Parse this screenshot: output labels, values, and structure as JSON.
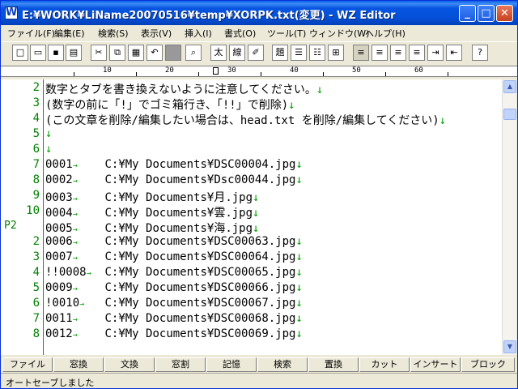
{
  "window": {
    "title": "E:¥WORK¥LiName20070516¥temp¥XORPK.txt(変更) - WZ Editor",
    "icon_glyph": "W"
  },
  "title_buttons": {
    "minimize": "_",
    "maximize": "□",
    "close": "✕"
  },
  "menu": [
    "ファイル(F)",
    "編集(E)",
    "検索(S)",
    "表示(V)",
    "挿入(I)",
    "書式(O)",
    "ツール(T)",
    "ウィンドウ(W)",
    "ヘルプ(H)"
  ],
  "toolbar": {
    "new": "□",
    "open": "▭",
    "save": "▪",
    "print": "▤",
    "cut": "✂",
    "copy": "⧉",
    "paste": "▦",
    "undo": "↶",
    "stop": "",
    "find": "⌕",
    "bold": "太",
    "underline": "線",
    "marker": "✐",
    "heading": "題",
    "bullets": "☰",
    "numbering": "☷",
    "table": "⊞",
    "align_left": "≡",
    "align_center": "≡",
    "align_right": "≡",
    "justify": "≡",
    "indent": "⇥",
    "outdent": "⇤",
    "help": "?"
  },
  "ruler": {
    "labels": [
      "10",
      "20",
      "30",
      "40",
      "50",
      "60"
    ]
  },
  "lines": [
    {
      "num": "2",
      "page": "",
      "text": "数字とタブを書き換えないように注意してください。",
      "tab": false,
      "tail": ""
    },
    {
      "num": "3",
      "page": "",
      "text": "(数字の前に「!」でゴミ箱行き、「!!」で削除)",
      "tab": false,
      "tail": ""
    },
    {
      "num": "4",
      "page": "",
      "text": "(この文章を削除/編集したい場合は、head.txt を削除/編集してください)",
      "tab": false,
      "tail": ""
    },
    {
      "num": "5",
      "page": "",
      "text": "",
      "tab": false,
      "tail": ""
    },
    {
      "num": "6",
      "page": "",
      "text": "",
      "tab": false,
      "tail": ""
    },
    {
      "num": "7",
      "page": "",
      "text": "0001",
      "tab": true,
      "tail": "C:¥My Documents¥DSC00004.jpg"
    },
    {
      "num": "8",
      "page": "",
      "text": "0002",
      "tab": true,
      "tail": "C:¥My Documents¥Dsc00044.jpg"
    },
    {
      "num": "9",
      "page": "",
      "text": "0003",
      "tab": true,
      "tail": "C:¥My Documents¥月.jpg"
    },
    {
      "num": "10",
      "page": "",
      "text": "0004",
      "tab": true,
      "tail": "C:¥My Documents¥雲.jpg"
    },
    {
      "num": "",
      "page": "P2",
      "text": "0005",
      "tab": true,
      "tail": "C:¥My Documents¥海.jpg"
    },
    {
      "num": "2",
      "page": "",
      "text": "0006",
      "tab": true,
      "tail": "C:¥My Documents¥DSC00063.jpg"
    },
    {
      "num": "3",
      "page": "",
      "text": "0007",
      "tab": true,
      "tail": "C:¥My Documents¥DSC00064.jpg"
    },
    {
      "num": "4",
      "page": "",
      "text": "!!0008",
      "tab": true,
      "tail": "C:¥My Documents¥DSC00065.jpg"
    },
    {
      "num": "5",
      "page": "",
      "text": "0009",
      "tab": true,
      "tail": "C:¥My Documents¥DSC00066.jpg"
    },
    {
      "num": "6",
      "page": "",
      "text": "!0010",
      "tab": true,
      "tail": "C:¥My Documents¥DSC00067.jpg"
    },
    {
      "num": "7",
      "page": "",
      "text": "0011",
      "tab": true,
      "tail": "C:¥My Documents¥DSC00068.jpg"
    },
    {
      "num": "8",
      "page": "",
      "text": "0012",
      "tab": true,
      "tail": "C:¥My Documents¥DSC00069.jpg"
    }
  ],
  "markers": {
    "linefeed": "↓",
    "tab": "→"
  },
  "function_keys": [
    "ファイル",
    "窓換",
    "文換",
    "窓割",
    "記憶",
    "検索",
    "置換",
    "カット",
    "インサート",
    "ブロック"
  ],
  "status": "オートセーブしました",
  "colors": {
    "title_blue": "#0655E0",
    "line_number_green": "#008000",
    "linefeed_green": "#00A000"
  }
}
